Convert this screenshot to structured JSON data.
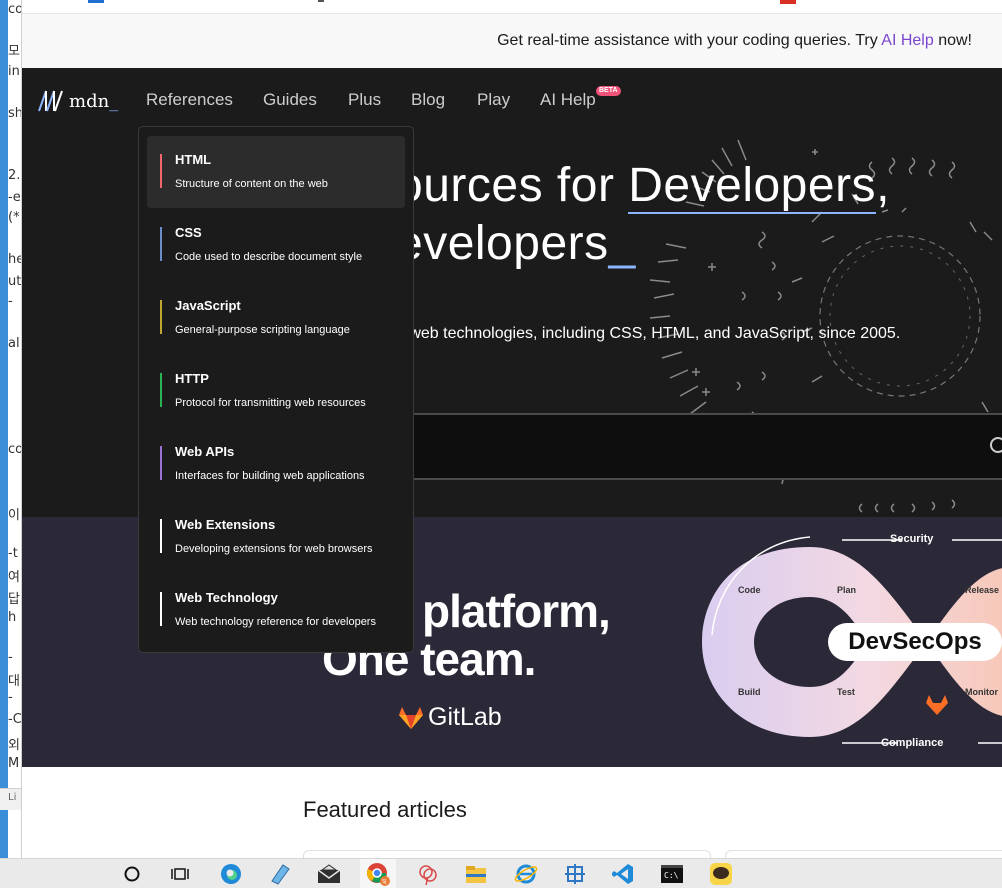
{
  "background_window": {
    "fragments": [
      "co",
      "모",
      "in",
      "sh",
      "2.",
      "-e",
      "(*",
      "he",
      "ut",
      "-",
      "al",
      "co",
      "이",
      "-t",
      "여",
      "답",
      "h",
      "-",
      "대",
      "-",
      "-C",
      "외",
      "M",
      "Li"
    ]
  },
  "banner": {
    "text_before": "Get real-time assistance with your coding queries. Try ",
    "link": "AI Help",
    "text_after": " now!"
  },
  "nav": {
    "logo_text": "mdn",
    "logo_underscore": "_",
    "items": [
      "References",
      "Guides",
      "Plus",
      "Blog",
      "Play",
      "AI Help"
    ],
    "beta_badge": "BETA"
  },
  "hero": {
    "title_line1": "ources for ",
    "title_link": "Developers",
    "title_comma": ",",
    "title_line2": "evelopers",
    "title_cursor": "_",
    "subtitle": "g web technologies, including CSS, HTML, and JavaScript, since 2005."
  },
  "dropdown": {
    "items": [
      {
        "title": "HTML",
        "desc": "Structure of content on the web",
        "color": "#f2676e"
      },
      {
        "title": "CSS",
        "desc": "Code used to describe document style",
        "color": "#6d8cc9"
      },
      {
        "title": "JavaScript",
        "desc": "General-purpose scripting language",
        "color": "#bfa731"
      },
      {
        "title": "HTTP",
        "desc": "Protocol for transmitting web resources",
        "color": "#2bb257"
      },
      {
        "title": "Web APIs",
        "desc": "Interfaces for building web applications",
        "color": "#9a72d2"
      },
      {
        "title": "Web Extensions",
        "desc": "Developing extensions for web browsers",
        "color": "#ffffff"
      },
      {
        "title": "Web Technology",
        "desc": "Web technology reference for developers",
        "color": "#ffffff"
      }
    ]
  },
  "ad": {
    "headline1": "platform,",
    "headline2": "One team.",
    "brand": "GitLab",
    "badge": "DevSecOps",
    "labels": {
      "security": "Security",
      "compliance": "Compliance",
      "code": "Code",
      "plan": "Plan",
      "release": "Release",
      "build": "Build",
      "test": "Test",
      "monitor": "Monitor"
    }
  },
  "featured": {
    "heading": "Featured articles"
  },
  "taskbar": {
    "icons": [
      "search-icon",
      "task-view-icon",
      "edge-icon",
      "notepad-icon",
      "mail-icon",
      "chrome-icon",
      "app-icon",
      "file-explorer-icon",
      "ie-icon",
      "network-icon",
      "vscode-icon",
      "terminal-icon",
      "kakaotalk-icon"
    ],
    "kakao_label": "TALK"
  }
}
